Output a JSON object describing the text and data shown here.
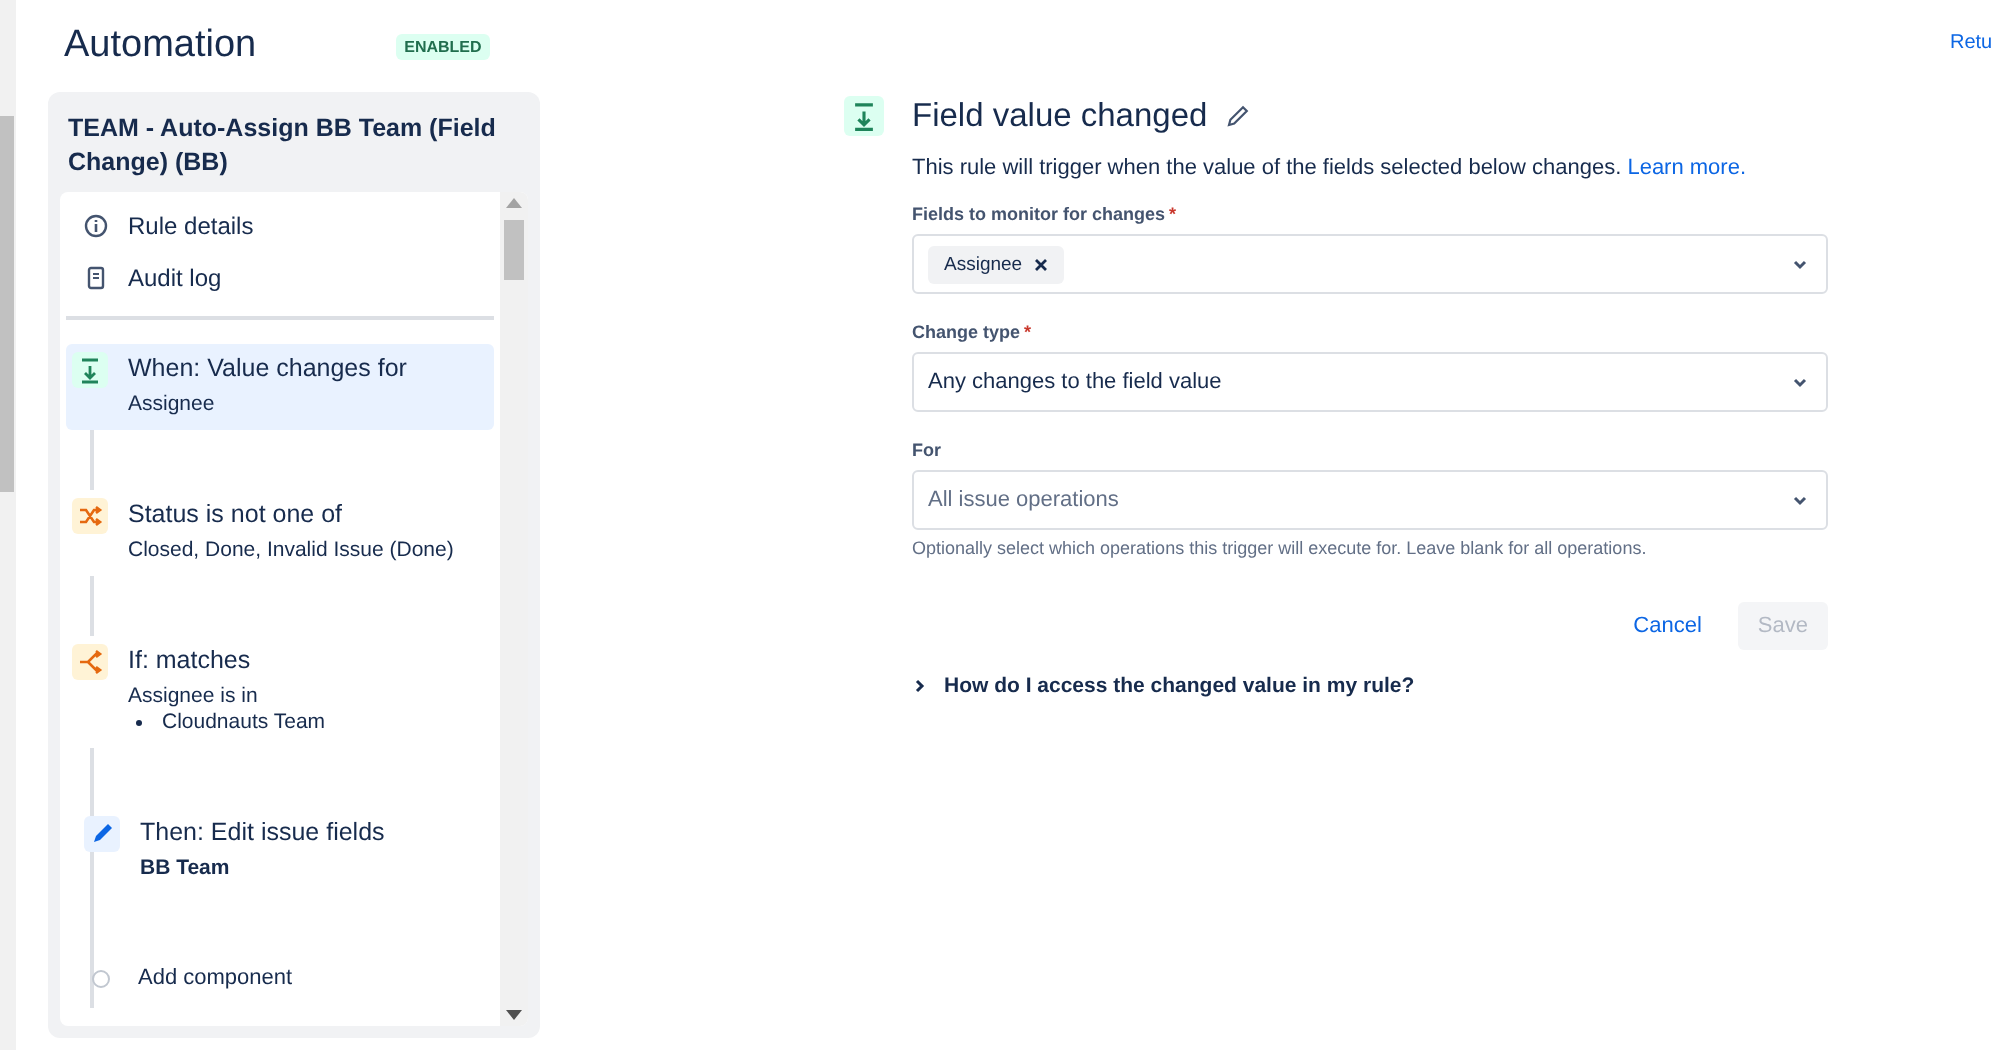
{
  "header": {
    "title": "Automation",
    "status_badge": "ENABLED"
  },
  "return_link": "Retu",
  "rule": {
    "name": "TEAM - Auto-Assign BB Team (Field Change) (BB)",
    "nav": [
      {
        "label": "Rule details",
        "kind": "info"
      },
      {
        "label": "Audit log",
        "kind": "log"
      }
    ],
    "components": [
      {
        "kind": "trigger",
        "title": "When: Value changes for",
        "detail": "Assignee",
        "selected": true
      },
      {
        "kind": "condition",
        "title": "Status is not one of",
        "detail": "Closed, Done, Invalid Issue (Done)",
        "selected": false
      },
      {
        "kind": "branch",
        "title": "If: matches",
        "detail": "Assignee is in",
        "bullets": [
          "Cloudnauts Team"
        ],
        "selected": false,
        "children": [
          {
            "kind": "action",
            "title": "Then: Edit issue fields",
            "detail": "BB Team"
          },
          {
            "kind": "add",
            "title": "Add component"
          }
        ]
      }
    ]
  },
  "editor": {
    "title": "Field value changed",
    "description": "This rule will trigger when the value of the fields selected below changes.",
    "learn_more": "Learn more.",
    "fields": [
      {
        "label": "Fields to monitor for changes",
        "required_mark": "*",
        "tags": [
          "Assignee"
        ]
      },
      {
        "label": "Change type",
        "required_mark": "*",
        "value": "Any changes to the field value"
      },
      {
        "label": "For",
        "placeholder": "All issue operations",
        "help": "Optionally select which operations this trigger will execute for. Leave blank for all operations."
      }
    ],
    "buttons": [
      {
        "label": "Cancel",
        "disabled": false
      },
      {
        "label": "Save",
        "disabled": true
      }
    ],
    "faq": {
      "label": "How do I access the changed value in my rule?",
      "expanded": false
    }
  }
}
